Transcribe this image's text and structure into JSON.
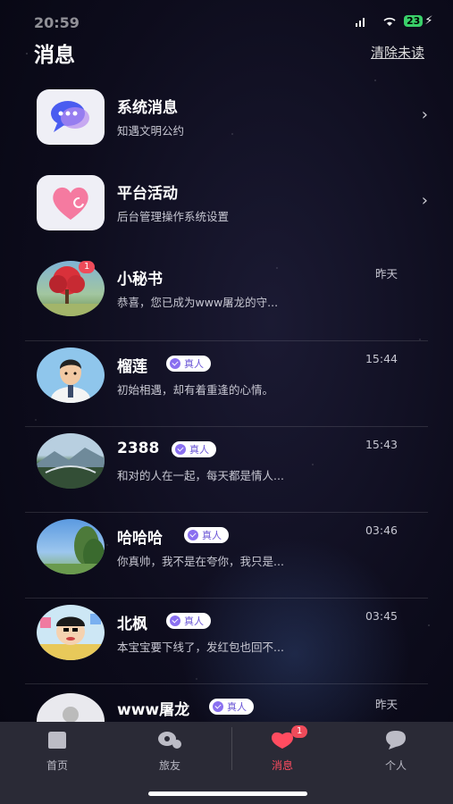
{
  "status": {
    "time": "20:59",
    "battery": "23"
  },
  "header": {
    "title": "消息",
    "clear_unread": "清除未读"
  },
  "system_rows": [
    {
      "name": "系统消息",
      "sub": "知遇文明公约",
      "icon": "chat-bubble-icon"
    },
    {
      "name": "平台活动",
      "sub": "后台管理操作系统设置",
      "icon": "heart-icon"
    }
  ],
  "conversations": [
    {
      "name": "小秘书",
      "preview": "恭喜，您已成为www屠龙的守...",
      "time": "昨天",
      "badge": "1",
      "verified": false
    },
    {
      "name": "榴莲",
      "preview": "初始相遇，却有着重逢的心情。",
      "time": "15:44",
      "verified": true,
      "verified_label": "真人"
    },
    {
      "name": "2388",
      "preview": "和对的人在一起，每天都是情人...",
      "time": "15:43",
      "verified": true,
      "verified_label": "真人"
    },
    {
      "name": "哈哈哈",
      "preview": "你真帅，我不是在夸你，我只是...",
      "time": "03:46",
      "verified": true,
      "verified_label": "真人"
    },
    {
      "name": "北枫",
      "preview": "本宝宝要下线了，发红包也回不...",
      "time": "03:45",
      "verified": true,
      "verified_label": "真人"
    },
    {
      "name": "www屠龙",
      "preview": "",
      "time": "昨天",
      "verified": true,
      "verified_label": "真人"
    }
  ],
  "tabs": [
    {
      "label": "首页",
      "icon": "home-icon"
    },
    {
      "label": "旅友",
      "icon": "friends-icon"
    },
    {
      "label": "消息",
      "icon": "messages-icon",
      "badge": "1",
      "active": true
    },
    {
      "label": "个人",
      "icon": "profile-icon"
    }
  ],
  "colors": {
    "accent": "#ff4c60",
    "verify": "#8a70f0",
    "tabbar": "#2a2a36"
  }
}
